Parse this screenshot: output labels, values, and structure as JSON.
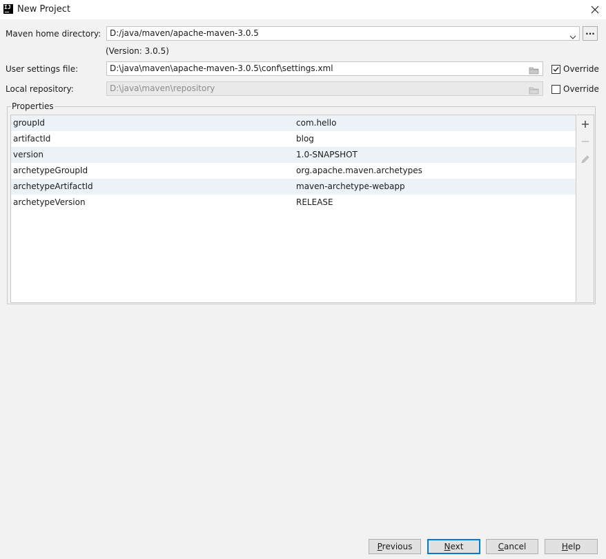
{
  "window": {
    "title": "New Project",
    "app_icon_text": "IJ"
  },
  "form": {
    "maven_home": {
      "label": "Maven home directory:",
      "value": "D:/java/maven/apache-maven-3.0.5",
      "browse_label": "...",
      "version_note": "(Version: 3.0.5)"
    },
    "user_settings": {
      "label": "User settings file:",
      "value": "D:\\java\\maven\\apache-maven-3.0.5\\conf\\settings.xml",
      "override_label": "Override",
      "override_checked": true
    },
    "local_repo": {
      "label": "Local repository:",
      "value": "D:\\java\\maven\\repository",
      "override_label": "Override",
      "override_checked": false
    }
  },
  "properties": {
    "legend": "Properties",
    "rows": [
      {
        "key": "groupId",
        "value": "com.hello"
      },
      {
        "key": "artifactId",
        "value": "blog"
      },
      {
        "key": "version",
        "value": "1.0-SNAPSHOT"
      },
      {
        "key": "archetypeGroupId",
        "value": "org.apache.maven.archetypes"
      },
      {
        "key": "archetypeArtifactId",
        "value": "maven-archetype-webapp"
      },
      {
        "key": "archetypeVersion",
        "value": "RELEASE"
      }
    ],
    "toolbar": [
      "plus-icon",
      "minus-icon",
      "pencil-icon"
    ]
  },
  "buttons": {
    "previous": {
      "mnemonic": "P",
      "rest": "revious"
    },
    "next": {
      "mnemonic": "N",
      "rest": "ext"
    },
    "cancel": {
      "mnemonic": "C",
      "rest": "ancel"
    },
    "help": {
      "mnemonic": "H",
      "rest": "elp"
    }
  },
  "colors": {
    "row_alt": "#edf2f8",
    "primary_border": "#0078d7",
    "background": "#f2f2f2"
  }
}
